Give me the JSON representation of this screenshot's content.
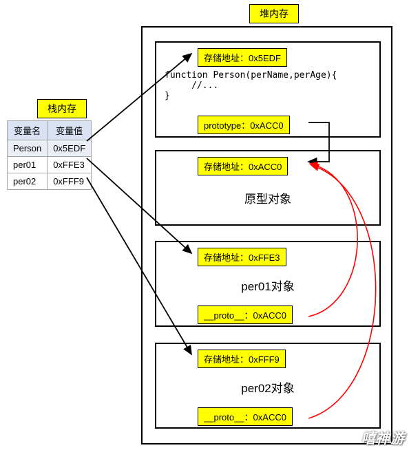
{
  "titles": {
    "stack": "栈内存",
    "heap": "堆内存"
  },
  "stack_table": {
    "headers": [
      "变量名",
      "变量值"
    ],
    "rows": [
      [
        "Person",
        "0x5EDF"
      ],
      [
        "per01",
        "0xFFE3"
      ],
      [
        "per02",
        "0xFFF9"
      ]
    ]
  },
  "heap": {
    "person_box": {
      "addr": "存储地址：0x5EDF",
      "code": "function Person(perName,perAge){\n     //...\n}",
      "prototype": "prototype：0xACC0"
    },
    "proto_obj": {
      "addr": "存储地址：0xACC0",
      "label": "原型对象"
    },
    "per01": {
      "addr": "存储地址：0xFFE3",
      "label": "per01对象",
      "proto": "__proto__：0xACC0"
    },
    "per02": {
      "addr": "存储地址：0xFFF9",
      "label": "per02对象",
      "proto": "__proto__：0xACC0"
    }
  },
  "watermark": "嘻神游"
}
